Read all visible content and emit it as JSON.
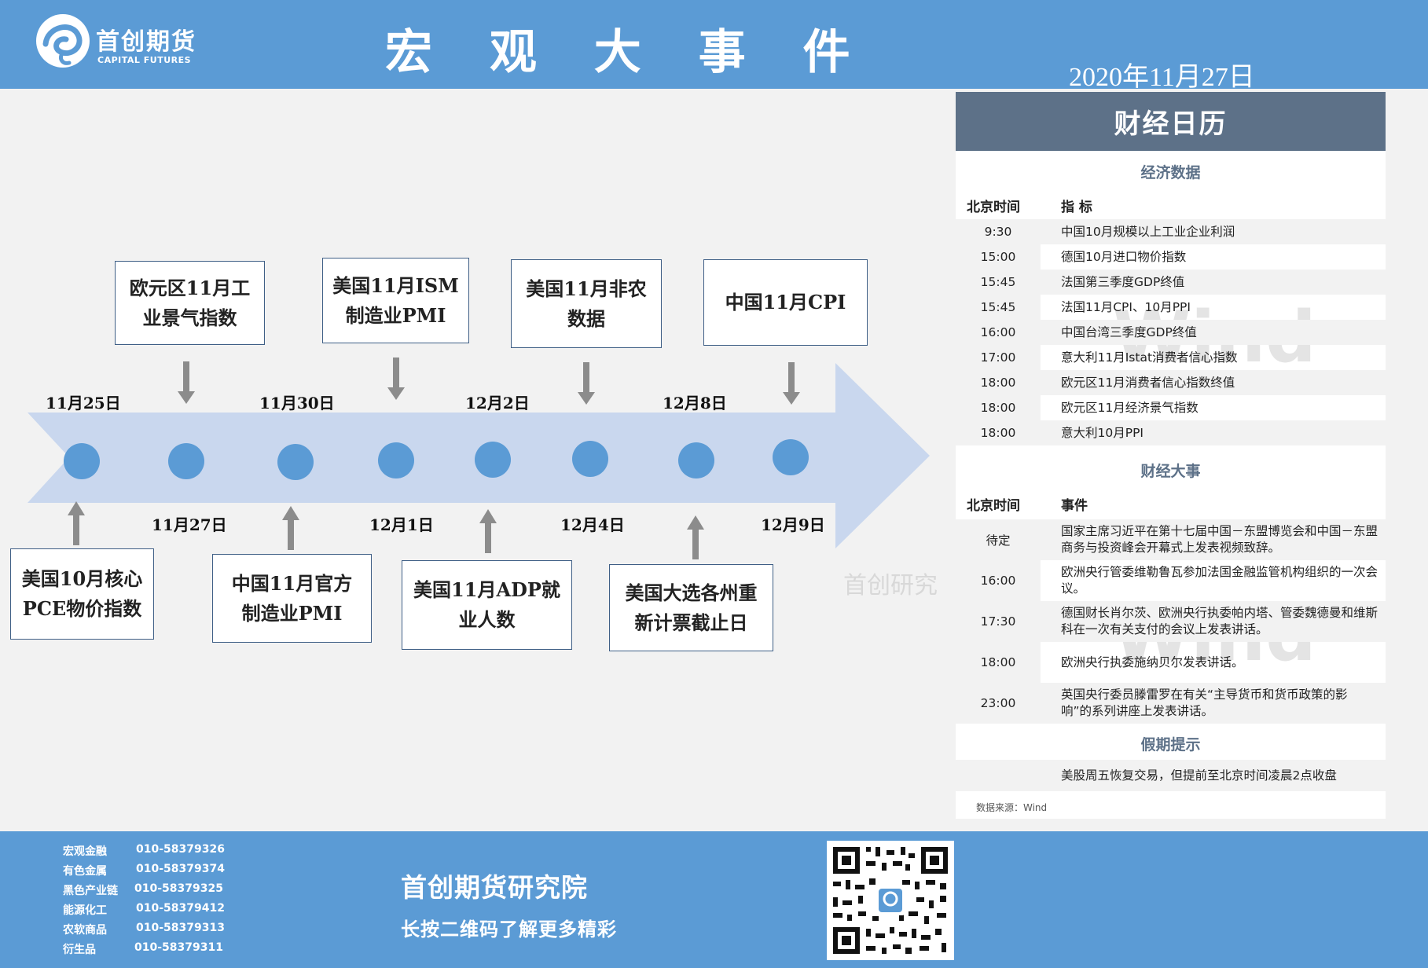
{
  "brand": {
    "name_cn": "首创期货",
    "name_en": "CAPITAL FUTURES"
  },
  "page_title": "宏 观 大 事 件",
  "date": "2020年11月27日",
  "timeline": {
    "top_dates": [
      "11月25日",
      "11月30日",
      "12月2日",
      "12月8日"
    ],
    "bottom_dates": [
      "11月27日",
      "12月1日",
      "12月4日",
      "12月9日"
    ],
    "events_above": [
      {
        "line1": "欧元区11月工",
        "line2": "业景气指数"
      },
      {
        "line1": "美国11月ISM",
        "line2": "制造业PMI"
      },
      {
        "line1": "美国11月非农",
        "line2": "数据"
      },
      {
        "line1": "中国11月CPI",
        "line2": ""
      }
    ],
    "events_below": [
      {
        "line1": "美国10月核心",
        "line2": "PCE物价指数"
      },
      {
        "line1": "中国11月官方",
        "line2": "制造业PMI"
      },
      {
        "line1": "美国11月ADP就",
        "line2": "业人数"
      },
      {
        "line1": "美国大选各州重",
        "line2": "新计票截止日"
      }
    ]
  },
  "calendar": {
    "title": "财经日历",
    "econ_section": "经济数据",
    "econ_headers": {
      "time": "北京时间",
      "item": "指  标"
    },
    "econ_rows": [
      {
        "time": "9:30",
        "item": "中国10月规模以上工业企业利润"
      },
      {
        "time": "15:00",
        "item": "德国10月进口物价指数"
      },
      {
        "time": "15:45",
        "item": "法国第三季度GDP终值"
      },
      {
        "time": "15:45",
        "item": "法国11月CPI、10月PPI"
      },
      {
        "time": "16:00",
        "item": "中国台湾三季度GDP终值"
      },
      {
        "time": "17:00",
        "item": "意大利11月Istat消费者信心指数"
      },
      {
        "time": "18:00",
        "item": "欧元区11月消费者信心指数终值"
      },
      {
        "time": "18:00",
        "item": "欧元区11月经济景气指数"
      },
      {
        "time": "18:00",
        "item": "意大利10月PPI"
      }
    ],
    "events_section": "财经大事",
    "events_headers": {
      "time": "北京时间",
      "item": "事件"
    },
    "event_rows": [
      {
        "time": "待定",
        "item": "国家主席习近平在第十七届中国－东盟博览会和中国－东盟商务与投资峰会开幕式上发表视频致辞。"
      },
      {
        "time": "16:00",
        "item": "欧洲央行管委维勒鲁瓦参加法国金融监管机构组织的一次会议。"
      },
      {
        "time": "17:30",
        "item": "德国财长肖尔茨、欧洲央行执委帕内塔、管委魏德曼和维斯科在一次有关支付的会议上发表讲话。"
      },
      {
        "time": "18:00",
        "item": "欧洲央行执委施纳贝尔发表讲话。"
      },
      {
        "time": "23:00",
        "item": "英国央行委员滕雷罗在有关“主导货币和货币政策的影响”的系列讲座上发表讲话。"
      }
    ],
    "holiday_section": "假期提示",
    "holiday_text": "美股周五恢复交易，但提前至北京时间凌晨2点收盘",
    "source": "数据来源：Wind"
  },
  "watermarks": {
    "wind": "Wind",
    "research": "首创研究"
  },
  "footer": {
    "contacts": [
      {
        "dept": "宏观金融",
        "phone": "010-58379326"
      },
      {
        "dept": "有色金属",
        "phone": "010-58379374"
      },
      {
        "dept": "黑色产业链",
        "phone": "010-58379325"
      },
      {
        "dept": "能源化工",
        "phone": "010-58379412"
      },
      {
        "dept": "农软商品",
        "phone": "010-58379313"
      },
      {
        "dept": "衍生品",
        "phone": "010-58379311"
      }
    ],
    "title": "首创期货研究院",
    "subtitle": "长按二维码了解更多精彩"
  },
  "colors": {
    "header_blue": "#5b9bd5",
    "panel_slate": "#5d7188",
    "arrow": "#c9d7ee",
    "dot": "#5b9bd5"
  }
}
